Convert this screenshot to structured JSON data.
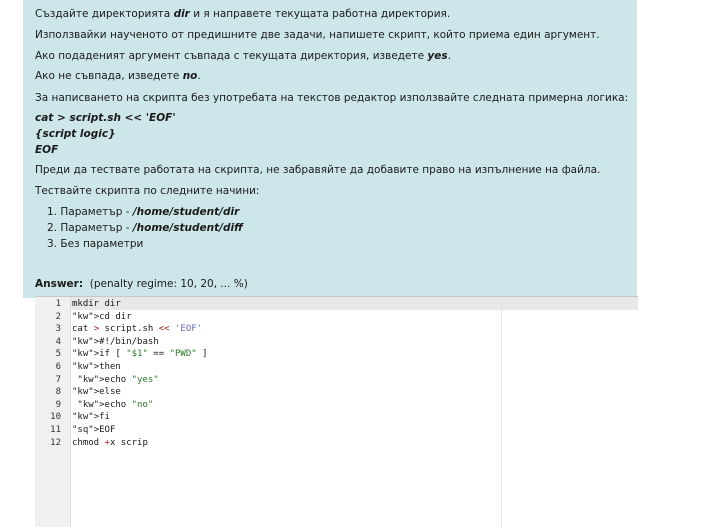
{
  "question": {
    "p1_pre": "Създайте директорията ",
    "p1_bold": "dir",
    "p1_post": " и я направете текущата работна директория.",
    "p2": "Използвайки наученото от предишните две задачи, напишете скрипт, който приема един аргумент.",
    "p3_pre": "Ако подаденият аргумент съвпада с текущата директория, изведете ",
    "p3_bold": "yes",
    "p3_post": ".",
    "p4_pre": "Ако не съвпада, изведете ",
    "p4_bold": "no",
    "p4_post": ".",
    "p5": "За написването на скрипта без употребата на текстов редактор използвайте следната примерна логика:",
    "code1": "cat > script.sh << 'EOF'",
    "code2": "{script logic}",
    "code3": "EOF",
    "p6": "Преди да тествате работата на скрипта, не забравяйте да добавите право на изпълнение на файла.",
    "p7": "Тествайте скрипта по следните начини:",
    "list": [
      {
        "num": "1. ",
        "pre": "Параметър - ",
        "bold": "/home/student/dir"
      },
      {
        "num": "2. ",
        "pre": "Параметър - ",
        "bold": "/home/student/diff"
      },
      {
        "num": "3. ",
        "pre": "Без параметри",
        "bold": ""
      }
    ]
  },
  "answer": {
    "label": "Answer:",
    "penalty": "(penalty regime: 10, 20, ... %)"
  },
  "editor": {
    "lines": [
      {
        "n": "1",
        "t": "mkdir dir"
      },
      {
        "n": "2",
        "t": "cd dir"
      },
      {
        "n": "3",
        "t": "cat > script.sh << 'EOF'"
      },
      {
        "n": "4",
        "t": "#!/bin/bash"
      },
      {
        "n": "5",
        "t": "if [ \"$1\" == \"PWD\" ]"
      },
      {
        "n": "6",
        "t": "then"
      },
      {
        "n": "7",
        "t": " echo \"yes\""
      },
      {
        "n": "8",
        "t": "else"
      },
      {
        "n": "9",
        "t": " echo \"no\""
      },
      {
        "n": "10",
        "t": "fi"
      },
      {
        "n": "11",
        "t": "EOF"
      },
      {
        "n": "12",
        "t": "chmod +x scrip"
      }
    ]
  },
  "colors": {
    "panel": "#cde6ea",
    "keyword": "#008800",
    "string": "#2a7a2a",
    "operator": "#aa2222"
  }
}
